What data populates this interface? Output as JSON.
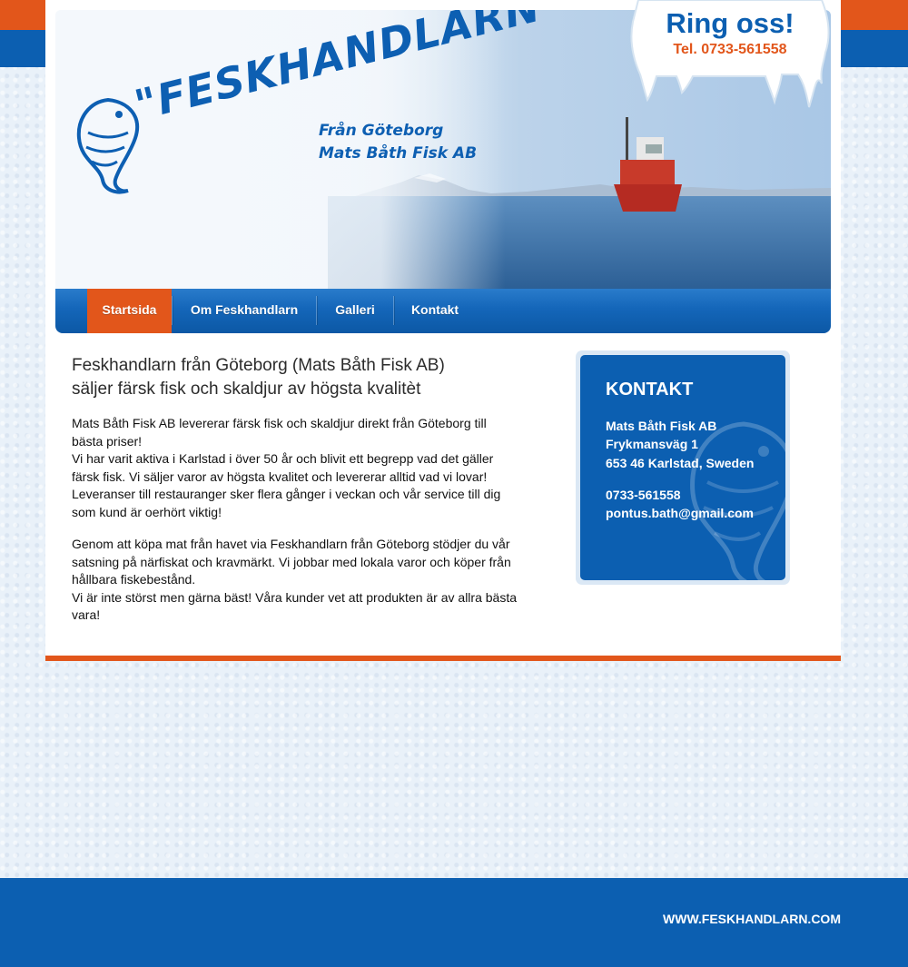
{
  "banner": {
    "logo_title": "\"FESKHANDLARN\"",
    "logo_sub1": "Från Göteborg",
    "logo_sub2": "Mats Båth Fisk AB",
    "callout_title": "Ring oss!",
    "callout_phone": "Tel. 0733-561558"
  },
  "nav": {
    "items": [
      {
        "label": "Startsida",
        "active": true
      },
      {
        "label": "Om Feskhandlarn",
        "active": false
      },
      {
        "label": "Galleri",
        "active": false
      },
      {
        "label": "Kontakt",
        "active": false
      }
    ]
  },
  "main": {
    "heading_line1": "Feskhandlarn från Göteborg (Mats Båth Fisk AB)",
    "heading_line2": "säljer färsk fisk och skaldjur av högsta kvalitèt",
    "para1_lines": [
      "Mats Båth Fisk AB levererar färsk fisk och skaldjur direkt från Göteborg till",
      "bästa priser!",
      "Vi har varit aktiva i Karlstad i över 50 år och blivit ett begrepp vad det gäller",
      "färsk fisk. Vi säljer varor av högsta kvalitet och levererar alltid vad vi lovar!",
      "Leveranser till restauranger sker flera gånger i veckan och vår service till dig",
      "som kund är oerhört viktig!"
    ],
    "para2_lines": [
      "Genom att köpa mat från havet via Feskhandlarn från Göteborg stödjer du vår",
      "satsning på närfiskat och kravmärkt. Vi jobbar med lokala varor och köper från",
      "hållbara fiskebestånd.",
      "Vi är inte störst men gärna bäst! Våra kunder vet att produkten är av allra bästa",
      "vara!"
    ]
  },
  "contact": {
    "title": "KONTAKT",
    "company": "Mats Båth Fisk AB",
    "street": "Frykmansväg 1",
    "city": "653 46 Karlstad, Sweden",
    "phone": "0733-561558",
    "email": "pontus.bath@gmail.com"
  },
  "footer": {
    "url": "WWW.FESKHANDLARN.COM"
  },
  "colors": {
    "brand_blue": "#0c5fb1",
    "accent_orange": "#e2561b"
  }
}
